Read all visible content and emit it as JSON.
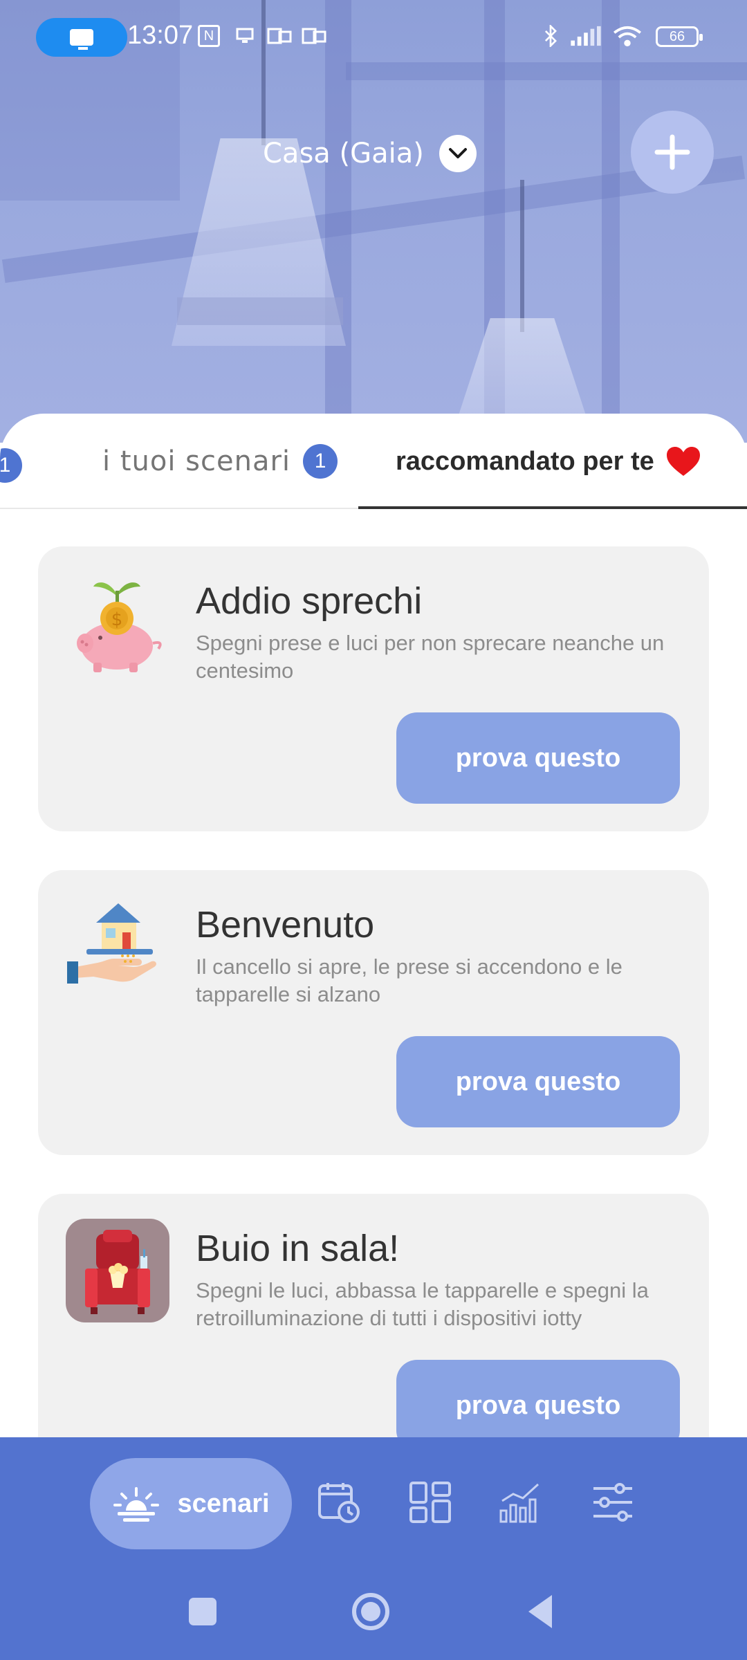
{
  "status_bar": {
    "time": "13:07",
    "battery": "66"
  },
  "header": {
    "home_name": "Casa (Gaia)"
  },
  "tabs": {
    "previous_badge": "1",
    "mine_label": "i tuoi scenari",
    "mine_badge": "1",
    "recommended_label": "raccomandato per te"
  },
  "cards": [
    {
      "title": "Addio sprechi",
      "description": "Spegni prese e luci per non sprecare neanche un centesimo",
      "button": "prova questo",
      "icon": "piggy-bank-icon"
    },
    {
      "title": "Benvenuto",
      "description": "Il cancello si apre, le prese si accendono e le tapparelle si alzano",
      "button": "prova questo",
      "icon": "house-in-hand-icon"
    },
    {
      "title": "Buio in sala!",
      "description": "Spegni le luci, abbassa le tapparelle e spegni la retroilluminazione di tutti i dispositivi iotty",
      "button": "prova questo",
      "icon": "cinema-seat-icon"
    }
  ],
  "bottom_nav": {
    "active_label": "scenari",
    "items": [
      "scenari-icon",
      "calendar-clock-icon",
      "dashboard-icon",
      "stats-icon",
      "settings-sliders-icon"
    ]
  },
  "colors": {
    "accent": "#5373cf",
    "button": "#89a3e4",
    "badge": "#4f74d1",
    "heart": "#e8161b"
  }
}
